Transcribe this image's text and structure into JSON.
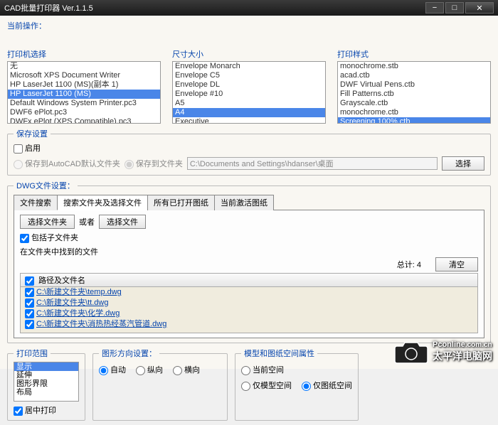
{
  "window": {
    "title": "CAD批量打印器 Ver.1.1.5"
  },
  "labels": {
    "current_op": "当前操作：",
    "printer": "打印机选择",
    "size": "尺寸大小",
    "style": "打印样式",
    "save_settings": "保存设置",
    "enable": "启用",
    "save_default": "保存到AutoCAD默认文件夹",
    "save_to": "保存到文件夹",
    "browse": "选择",
    "dwg_settings": "DWG文件设置：",
    "tabs": [
      "文件搜索",
      "搜索文件夹及选择文件",
      "所有已打开图纸",
      "当前激活图纸"
    ],
    "active_tab": 1,
    "select_folder": "选择文件夹",
    "or": "或者",
    "select_file": "选择文件",
    "include_sub": "包括子文件夹",
    "found_in_folder": "在文件夹中找到的文件",
    "total_prefix": "总计:",
    "clear": "清空",
    "col_path": "路径及文件名",
    "print_range": "打印范围",
    "center_print": "居中打印",
    "orient": "图形方向设置：",
    "auto": "自动",
    "portrait": "纵向",
    "landscape": "横向",
    "space": "模型和图纸空间属性",
    "current_space": "当前空间",
    "model_only": "仅模型空间",
    "paper_only": "仅图纸空间",
    "save_path": "C:\\Documents and Settings\\hdanser\\桌面"
  },
  "printers": {
    "items": [
      "无",
      "Microsoft XPS Document Writer",
      "HP LaserJet 1100 (MS)(副本 1)",
      "HP LaserJet 1100 (MS)",
      "Default Windows System Printer.pc3",
      "DWF6 ePlot.pc3",
      "DWFx ePlot (XPS Compatible).pc3"
    ],
    "selected": 3
  },
  "sizes": {
    "items": [
      "Envelope Monarch",
      "Envelope C5",
      "Envelope DL",
      "Envelope #10",
      "A5",
      "A4",
      "Executive"
    ],
    "selected": 5
  },
  "styles": {
    "items": [
      "monochrome.stb",
      "acad.ctb",
      "DWF Virtual Pens.ctb",
      "Fill Patterns.ctb",
      "Grayscale.ctb",
      "monochrome.ctb",
      "Screening 100%.ctb"
    ],
    "selected": 6
  },
  "files": {
    "total": 4,
    "rows": [
      "C:\\新建文件夹\\temp.dwg",
      "C:\\新建文件夹\\tt.dwg",
      "C:\\新建文件夹\\化学.dwg",
      "C:\\新建文件夹\\消热热经蒸汽管道.dwg"
    ]
  },
  "ranges": {
    "items": [
      "显示",
      "延伸",
      "图形界限",
      "布局"
    ],
    "selected": 0
  },
  "watermark": {
    "brand_en": "Pconline",
    "brand_suffix": ".com.cn",
    "brand_zh": "太平洋电脑网"
  }
}
